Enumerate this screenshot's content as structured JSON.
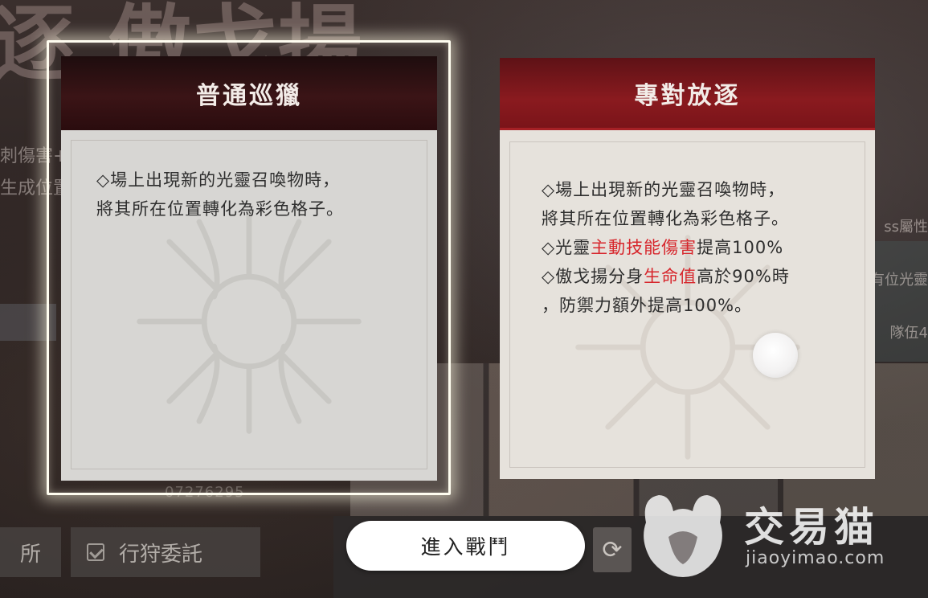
{
  "background": {
    "title": "逐.傲戈揚",
    "side_text_1": "刺傷害+",
    "side_text_2": "生成位置",
    "right_text_1": "ss屬性",
    "right_text_2": "有位光靈",
    "right_text_3": "隊伍4",
    "number_text": "07276295"
  },
  "cards": {
    "normal": {
      "title": "普通巡獵",
      "lines": [
        "◇場上出現新的光靈召喚物時，",
        "將其所在位置轉化為彩色格子。"
      ],
      "selected": true
    },
    "exile": {
      "title": "專對放逐",
      "line1": "◇場上出現新的光靈召喚物時，",
      "line2": "將其所在位置轉化為彩色格子。",
      "line3_pre": "◇光靈",
      "line3_hl": "主動技能傷害",
      "line3_post": "提高100%",
      "line4_pre": "◇傲戈揚分身",
      "line4_hl": "生命值",
      "line4_post": "高於90%時",
      "line5": "，防禦力額外提高100%。"
    }
  },
  "bottom": {
    "left_button_label": "所",
    "hunt_button_label": "行狩委託",
    "enter_battle_label": "進入戰鬥",
    "refresh_icon": "refresh-icon"
  },
  "watermark": {
    "brand": "交易猫",
    "url": "jiaoyimao.com"
  },
  "colors": {
    "highlight": "#d7262c",
    "exile_header": "#8a1a1f",
    "normal_header": "#2a0c0e",
    "selection_glow": "#fffdf0"
  }
}
